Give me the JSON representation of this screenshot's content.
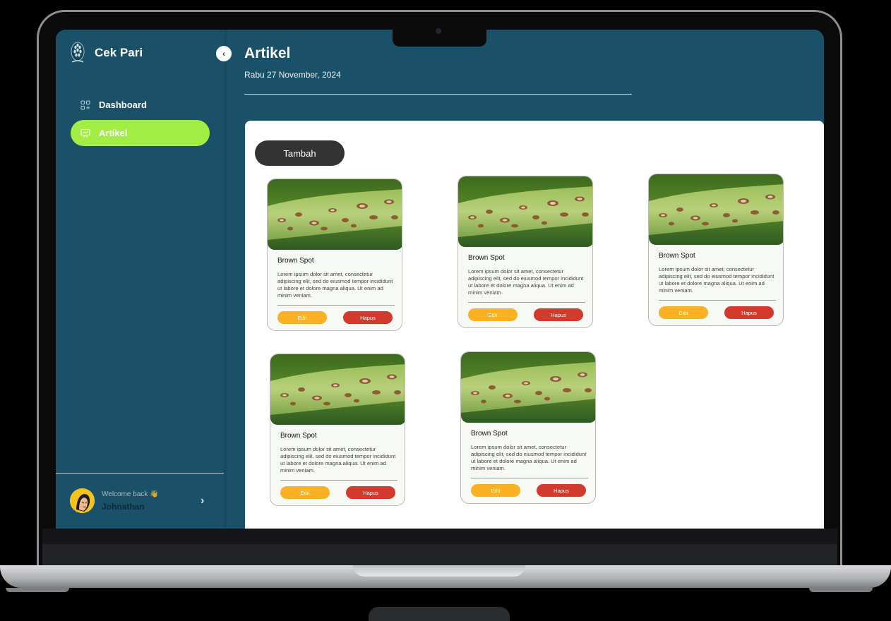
{
  "app": {
    "name": "Cek Pari"
  },
  "sidebar": {
    "items": [
      {
        "label": "Dashboard",
        "active": false,
        "icon": "grid-plus-icon"
      },
      {
        "label": "Artikel",
        "active": true,
        "icon": "presentation-icon"
      }
    ],
    "user": {
      "welcome": "Welcome back 👋",
      "name": "Johnathan"
    }
  },
  "header": {
    "title": "Artikel",
    "date": "Rabu 27 November, 2024"
  },
  "content": {
    "add_label": "Tambah",
    "cards": [
      {
        "title": "Brown Spot",
        "text": "Lorem ipsum dolor sit amet, consectetur adipiscing elit, sed do eiusmod tempor incididunt ut labore et dolore magna aliqua. Ut enim ad minim veniam.",
        "edit": "Edit",
        "delete": "Hapus"
      },
      {
        "title": "Brown Spot",
        "text": "Lorem ipsum dolor sit amet, consectetur adipiscing elit, sed do eiusmod tempor incididunt ut labore et dolore magna aliqua. Ut enim ad minim veniam.",
        "edit": "Edit",
        "delete": "Hapus"
      },
      {
        "title": "Brown Spot",
        "text": "Lorem ipsum dolor sit amet, consectetur adipiscing elit, sed do eiusmod tempor incididunt ut labore et dolore magna aliqua. Ut enim ad minim veniam.",
        "edit": "Edit",
        "delete": "Hapus"
      },
      {
        "title": "Brown Spot",
        "text": "Lorem ipsum dolor sit amet, consectetur adipiscing elit, sed do eiusmod tempor incididunt ut labore et dolore magna aliqua. Ut enim ad minim veniam.",
        "edit": "Edit",
        "delete": "Hapus"
      },
      {
        "title": "Brown Spot",
        "text": "Lorem ipsum dolor sit amet, consectetur adipiscing elit, sed do eiusmod tempor incididunt ut labore et dolore magna aliqua. Ut enim ad minim veniam.",
        "edit": "Edit",
        "delete": "Hapus"
      }
    ]
  },
  "colors": {
    "primary": "#1a5168",
    "nav_active": "#a3ee44",
    "edit": "#fbb123",
    "delete": "#d23a2e",
    "add_button": "#333333"
  }
}
